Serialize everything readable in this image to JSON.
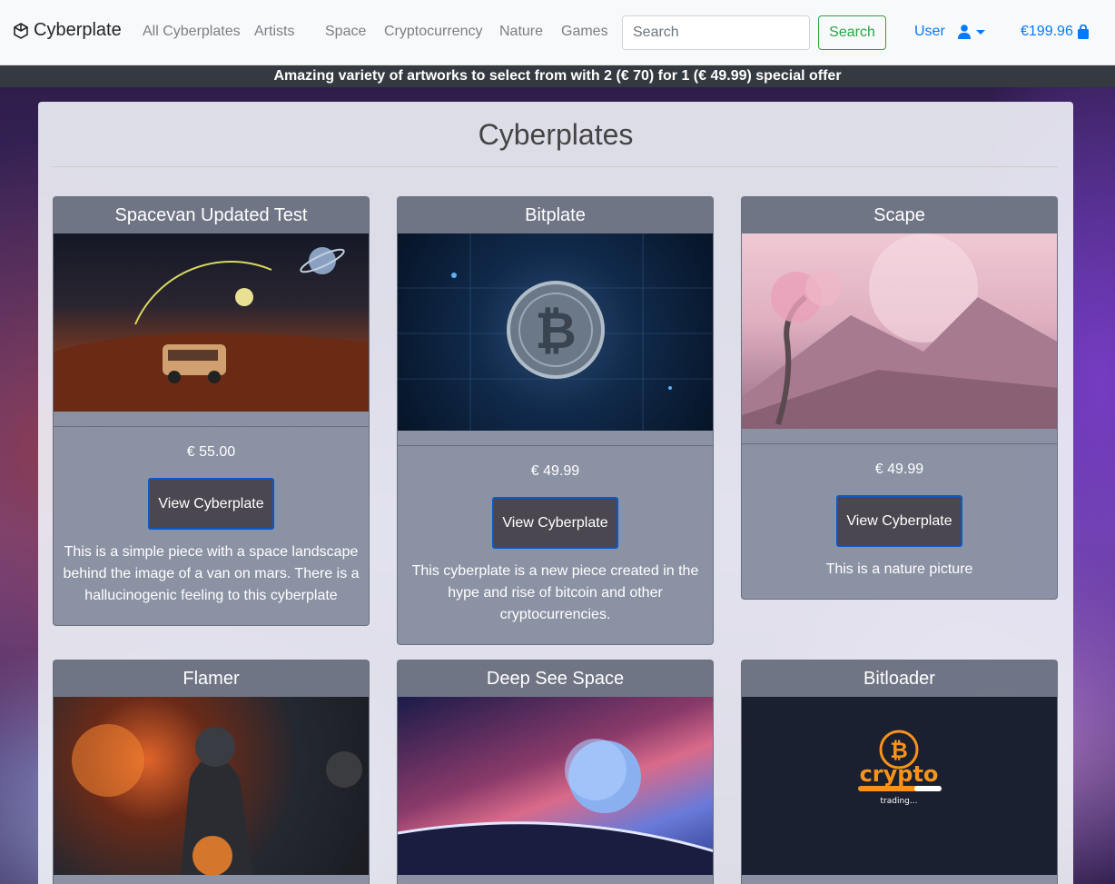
{
  "navbar": {
    "brand": "Cyberplate",
    "links": [
      "All Cyberplates",
      "Artists",
      "Space",
      "Cryptocurrency",
      "Nature",
      "Games"
    ],
    "search_placeholder": "Search",
    "search_button": "Search",
    "user_label": "User",
    "cart_total": "€199.96"
  },
  "promo": {
    "text": "Amazing variety of artworks to select from with 2 (€ 70) for 1 (€ 49.99) special offer"
  },
  "page": {
    "title": "Cyberplates"
  },
  "cards": [
    {
      "title": "Spacevan Updated Test",
      "price": "€ 55.00",
      "button": "View Cyberplate",
      "description": "This is a simple piece with a space landscape behind the image of a van on mars. There is a hallucinogenic feeling to this cyberplate"
    },
    {
      "title": "Bitplate",
      "price": "€ 49.99",
      "button": "View Cyberplate",
      "description": "This cyberplate is a new piece created in the hype and rise of bitcoin and other cryptocurrencies."
    },
    {
      "title": "Scape",
      "price": "€ 49.99",
      "button": "View Cyberplate",
      "description": "This is a nature picture"
    },
    {
      "title": "Flamer"
    },
    {
      "title": "Deep See Space"
    },
    {
      "title": "Bitloader",
      "logo_text": "crypto",
      "logo_subtext": "trading..."
    }
  ],
  "colors": {
    "primary": "#007bff",
    "success": "#28a745",
    "dark": "#343a40"
  }
}
